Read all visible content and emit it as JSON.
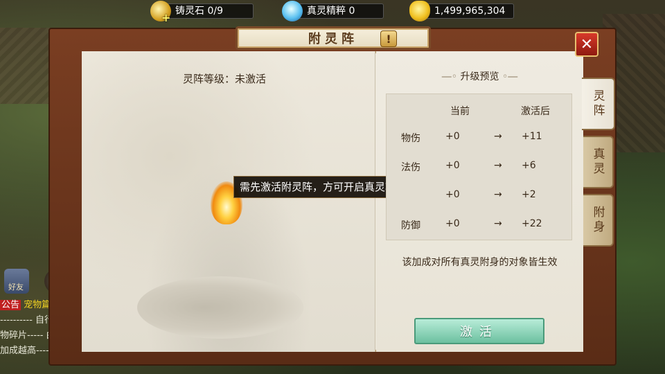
{
  "resources": {
    "forge_stone": {
      "label": "铸灵石",
      "value": "0/9"
    },
    "essence": {
      "label": "真灵精粹",
      "value": "0"
    },
    "gold": {
      "value": "1,499,965,304"
    }
  },
  "panel": {
    "title": "附灵阵",
    "info_label": "!",
    "close_label": "✕"
  },
  "left": {
    "level_text": "灵阵等级：未激活",
    "tooltip": "需先激活附灵阵，方可开启真灵功能。"
  },
  "preview": {
    "title": "升级预览",
    "col_current": "当前",
    "col_after": "激活后",
    "arrow": "→",
    "rows": [
      {
        "name": "物伤",
        "current": "+0",
        "after": "+11"
      },
      {
        "name": "法伤",
        "current": "+0",
        "after": "+6"
      },
      {
        "name": "",
        "current": "+0",
        "after": "+2"
      },
      {
        "name": "防御",
        "current": "+0",
        "after": "+22"
      }
    ],
    "note": "该加成对所有真灵附身的对象皆生效"
  },
  "activate_label": "激活",
  "tabs": [
    "灵阵",
    "真灵",
    "附身"
  ],
  "side": {
    "friend_label": "好友",
    "chat": {
      "notice_tag": "公告",
      "notice_text": "宠物篇【",
      "line2": "---------- 自行",
      "line3": "物碎片----- 由",
      "line4": "加成越高----"
    }
  },
  "colors": {
    "frame": "#6a3420",
    "parchment": "#eee9dc",
    "activate": "#7fcfb0",
    "close": "#c0301f"
  }
}
